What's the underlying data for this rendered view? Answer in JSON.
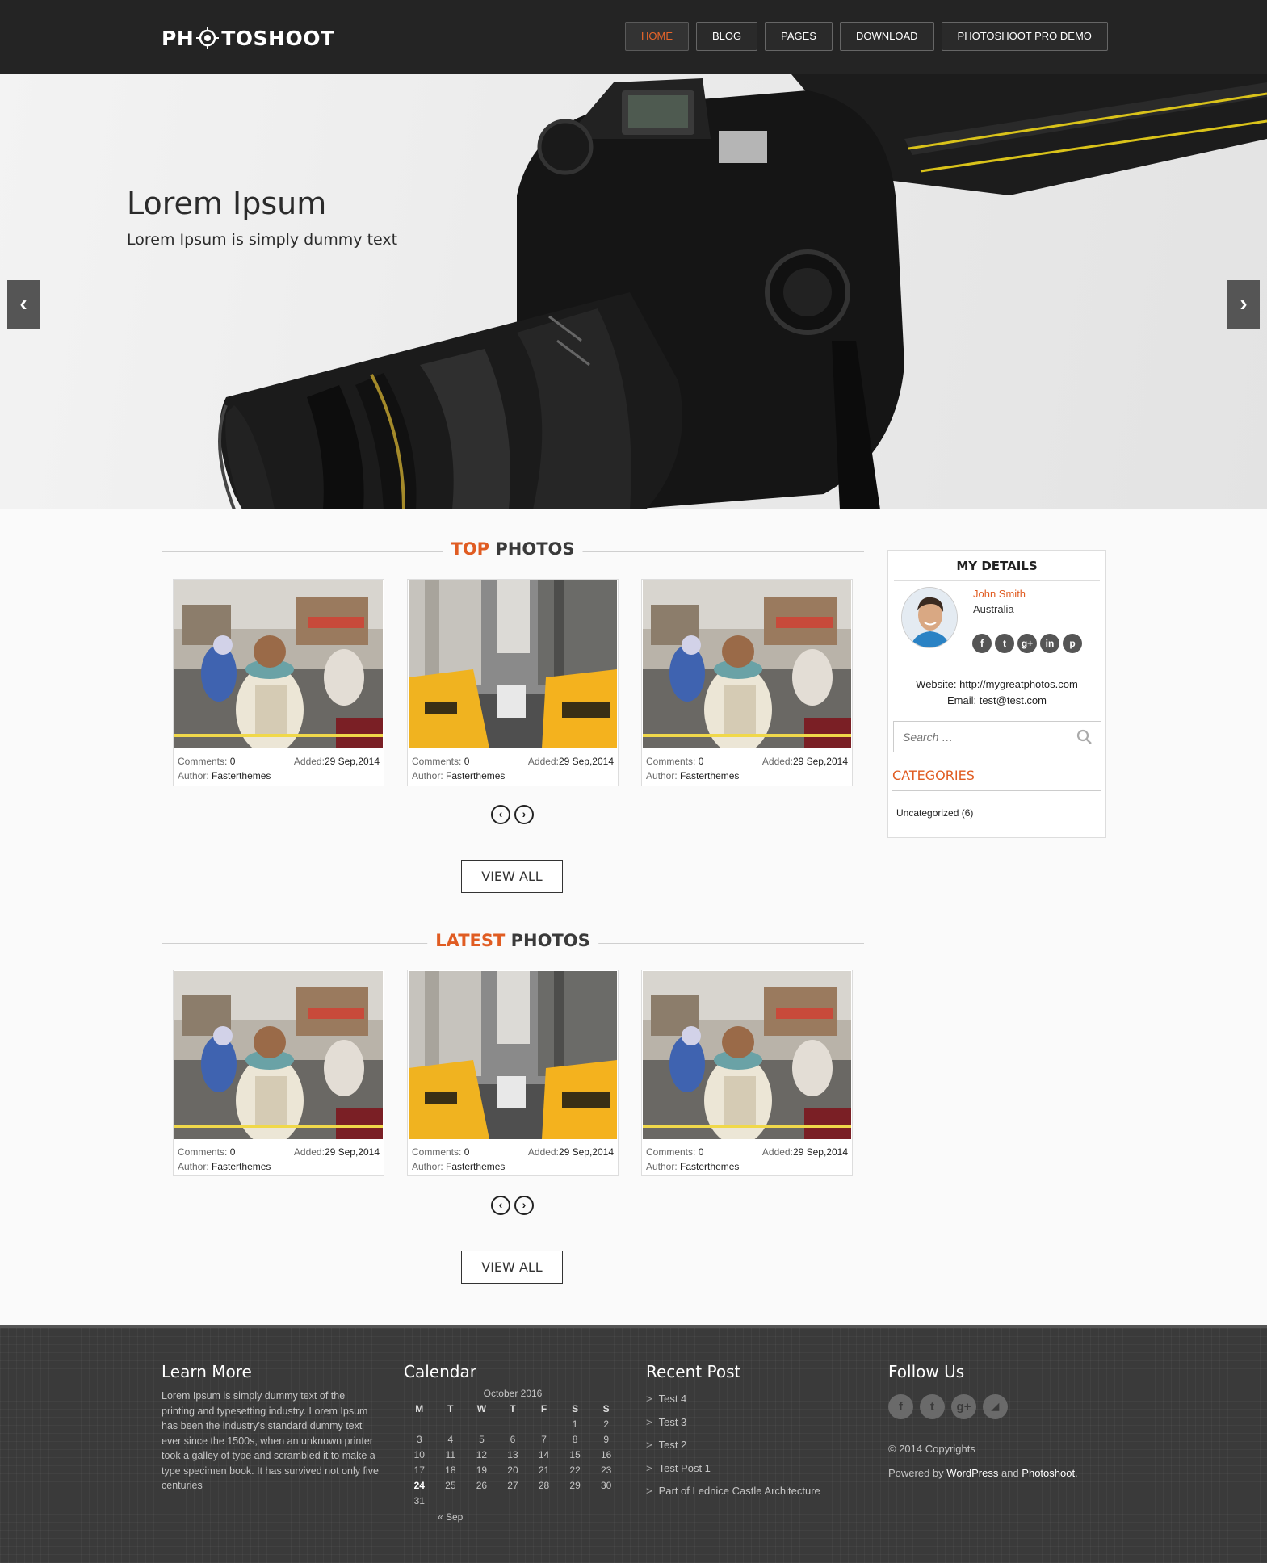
{
  "header": {
    "logo_left": "PH",
    "logo_right": "TOSHOOT",
    "nav": [
      "HOME",
      "BLOG",
      "PAGES",
      "DOWNLOAD",
      "PHOTOSHOOT PRO DEMO"
    ],
    "active_nav": "HOME"
  },
  "hero": {
    "title": "Lorem Ipsum",
    "subtitle": "Lorem Ipsum is simply dummy text",
    "prev_icon": "‹",
    "next_icon": "›"
  },
  "top_photos": {
    "title_accent": "TOP",
    "title_rest": "PHOTOS",
    "cards": [
      {
        "photo": "street-scooter",
        "comments_label": "Comments:",
        "comments": "0",
        "added_label": "Added:",
        "added": "29 Sep,2014",
        "author_label": "Author:",
        "author": "Fasterthemes"
      },
      {
        "photo": "city-taxis",
        "comments_label": "Comments:",
        "comments": "0",
        "added_label": "Added:",
        "added": "29 Sep,2014",
        "author_label": "Author:",
        "author": "Fasterthemes"
      },
      {
        "photo": "street-scooter",
        "comments_label": "Comments:",
        "comments": "0",
        "added_label": "Added:",
        "added": "29 Sep,2014",
        "author_label": "Author:",
        "author": "Fasterthemes"
      }
    ],
    "view_all": "VIEW ALL"
  },
  "latest_photos": {
    "title_accent": "LATEST",
    "title_rest": "PHOTOS",
    "cards": [
      {
        "photo": "street-scooter",
        "comments_label": "Comments:",
        "comments": "0",
        "added_label": "Added:",
        "added": "29 Sep,2014",
        "author_label": "Author:",
        "author": "Fasterthemes"
      },
      {
        "photo": "city-taxis",
        "comments_label": "Comments:",
        "comments": "0",
        "added_label": "Added:",
        "added": "29 Sep,2014",
        "author_label": "Author:",
        "author": "Fasterthemes"
      },
      {
        "photo": "street-scooter",
        "comments_label": "Comments:",
        "comments": "0",
        "added_label": "Added:",
        "added": "29 Sep,2014",
        "author_label": "Author:",
        "author": "Fasterthemes"
      }
    ],
    "view_all": "VIEW ALL"
  },
  "pager": {
    "prev": "‹",
    "next": "›"
  },
  "sidebar": {
    "heading": "MY DETAILS",
    "name": "John Smith",
    "country": "Australia",
    "social": [
      "f",
      "t",
      "g+",
      "in",
      "p"
    ],
    "website": "Website: http://mygreatphotos.com",
    "email": "Email: test@test.com",
    "search_placeholder": "Search …",
    "categories_title": "CATEGORIES",
    "category_item": "Uncategorized (6)"
  },
  "footer": {
    "learn_title": "Learn More",
    "learn_text": "Lorem Ipsum is simply dummy text of the printing and typesetting industry. Lorem Ipsum has been the industry's standard dummy text ever since the 1500s, when an unknown printer took a galley of type and scrambled it to make a type specimen book. It has survived not only five centuries",
    "calendar_title": "Calendar",
    "calendar_caption": "October 2016",
    "calendar_days": [
      "M",
      "T",
      "W",
      "T",
      "F",
      "S",
      "S"
    ],
    "calendar_weeks": [
      [
        "",
        "",
        "",
        "",
        "",
        "1",
        "2"
      ],
      [
        "3",
        "4",
        "5",
        "6",
        "7",
        "8",
        "9"
      ],
      [
        "10",
        "11",
        "12",
        "13",
        "14",
        "15",
        "16"
      ],
      [
        "17",
        "18",
        "19",
        "20",
        "21",
        "22",
        "23"
      ],
      [
        "24",
        "25",
        "26",
        "27",
        "28",
        "29",
        "30"
      ],
      [
        "31",
        "",
        "",
        "",
        "",
        "",
        ""
      ]
    ],
    "calendar_today": "24",
    "calendar_prev": "« Sep",
    "recent_title": "Recent Post",
    "recent_posts": [
      "Test 4",
      "Test 3",
      "Test 2",
      "Test Post 1",
      "Part of Lednice Castle Architecture"
    ],
    "follow_title": "Follow Us",
    "follow_icons": [
      "f",
      "t",
      "g+",
      "rss"
    ],
    "copyright": "© 2014 Copyrights",
    "powered_prefix": "Powered by",
    "powered_wp": "WordPress",
    "powered_and": "and",
    "powered_theme": "Photoshoot",
    "powered_suffix": "."
  }
}
